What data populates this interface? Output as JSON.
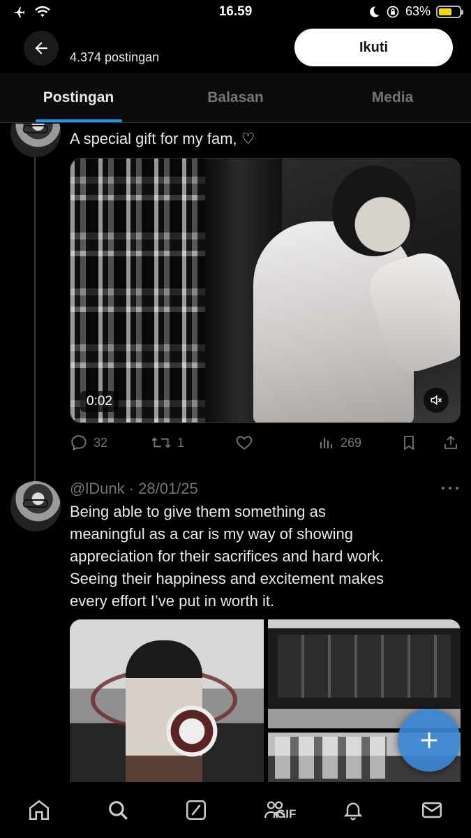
{
  "status_bar": {
    "time": "16.59",
    "battery": "63%"
  },
  "header": {
    "post_count": "4.374 postingan",
    "follow_label": "Ikuti"
  },
  "tabs": [
    {
      "label": "Postingan",
      "active": true
    },
    {
      "label": "Balasan",
      "active": false
    },
    {
      "label": "Media",
      "active": false
    }
  ],
  "post1": {
    "text": "A special gift for my fam, ♡",
    "video_time": "0:02",
    "replies": "32",
    "reposts": "1",
    "views": "269"
  },
  "post2": {
    "handle_date": "@lDunk · 28/01/25",
    "text_lines": [
      "Being able to give them something as",
      "meaningful as a car is my way of showing",
      "appreciation for their sacrifices and hard work.",
      "Seeing their happiness and excitement makes",
      "every effort I’ve put in worth it."
    ]
  },
  "bottom_nav": {
    "gif_label": "GIF"
  },
  "colors": {
    "accent": "#1d9bf0",
    "fab": "#3a87d4",
    "battery": "#f5d90a"
  }
}
